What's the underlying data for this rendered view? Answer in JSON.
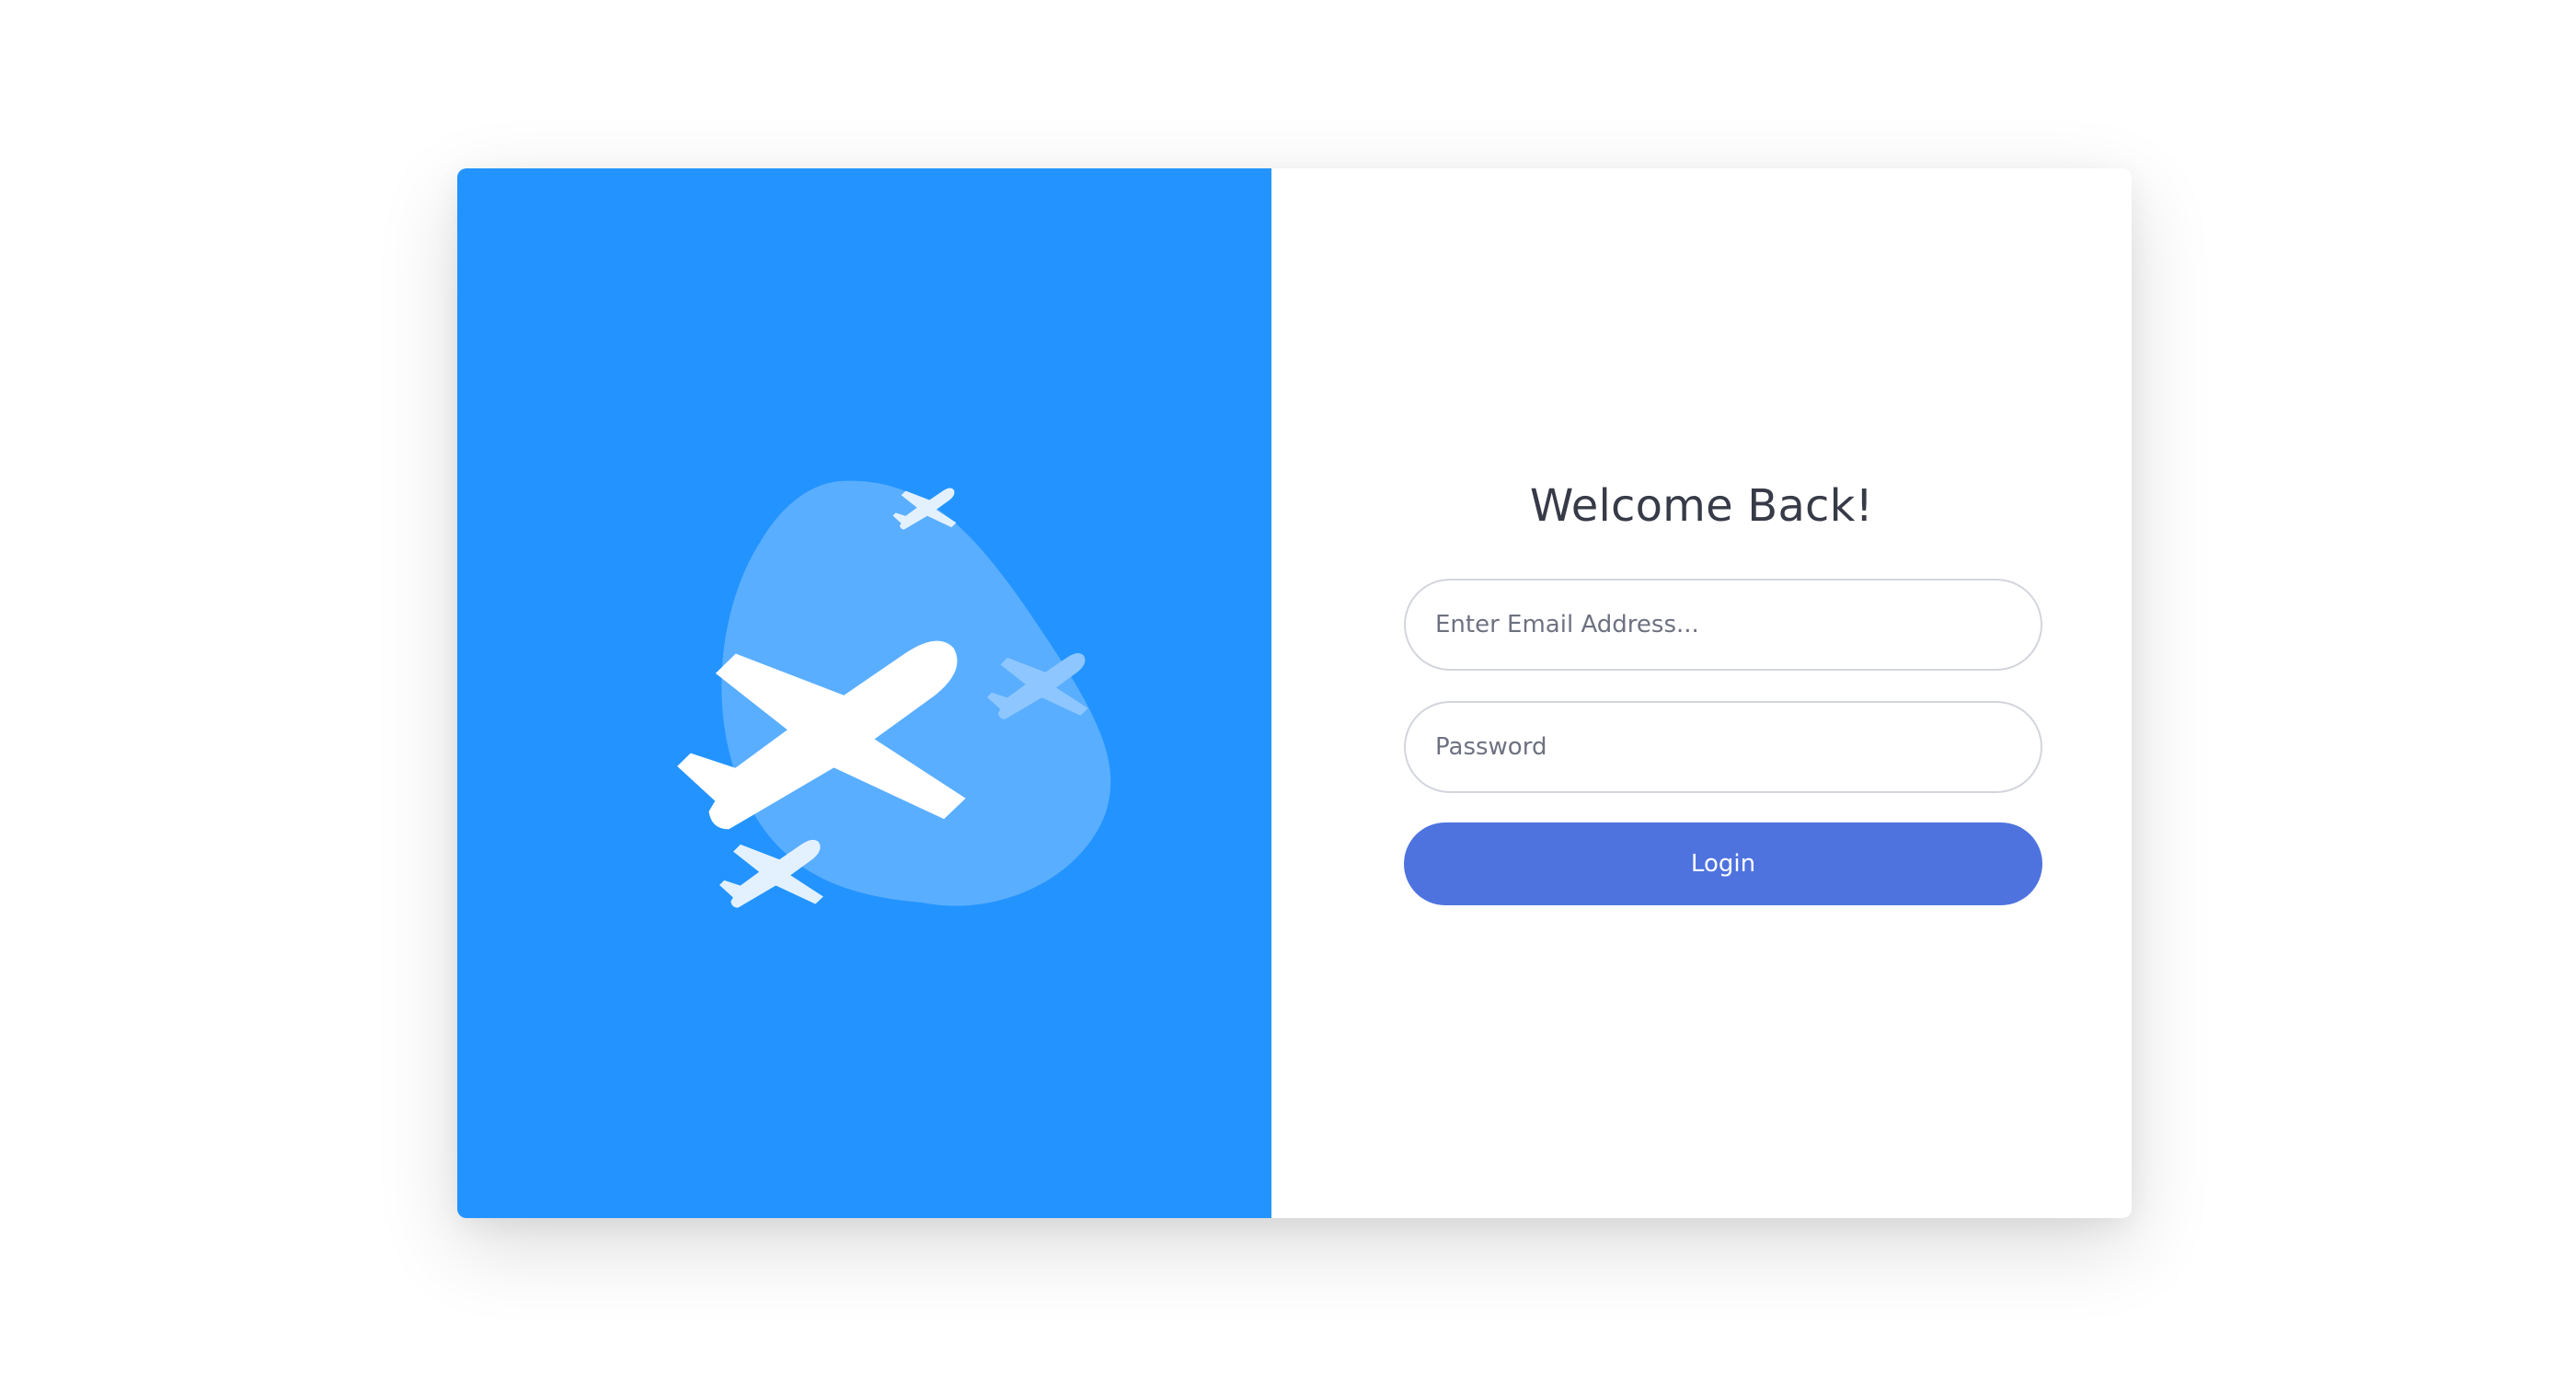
{
  "login": {
    "title": "Welcome Back!",
    "email_placeholder": "Enter Email Address...",
    "password_placeholder": "Password",
    "login_label": "Login"
  },
  "colors": {
    "panel_blue": "#2394ff",
    "blob": "#5aaeff",
    "plane_white": "#ffffff",
    "plane_light": "#e3f1ff",
    "plane_mid": "#8ec7ff",
    "button": "#4e73df",
    "title_text": "#373a47",
    "field_border": "#d3d5dd"
  },
  "icons": {
    "illustration": "airplane-illustration",
    "main": "airplane-takeoff-icon",
    "small": "small-airplane-icon"
  }
}
